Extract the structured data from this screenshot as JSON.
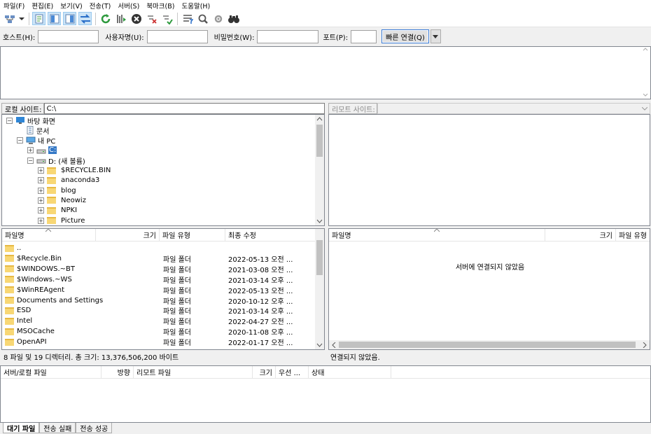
{
  "menu": [
    "파일(F)",
    "편집(E)",
    "보기(V)",
    "전송(T)",
    "서버(S)",
    "북마크(B)",
    "도움말(H)"
  ],
  "toolbar_icons": [
    "site-manager-icon",
    "dropdown-arrow-icon",
    "toggle-log-icon",
    "toggle-local-tree-icon",
    "toggle-remote-tree-icon",
    "toggle-queue-icon",
    "refresh-icon",
    "process-queue-icon",
    "cancel-icon",
    "disconnect-icon",
    "reconnect-icon",
    "directory-filter-icon",
    "dir-compare-icon",
    "sync-browse-icon",
    "search-remote-icon"
  ],
  "quickconnect": {
    "host_label": "호스트(H):",
    "user_label": "사용자명(U):",
    "password_label": "비밀번호(W):",
    "port_label": "포트(P):",
    "connect_label": "빠른 연결(Q)"
  },
  "local": {
    "site_label": "로컬 사이트:",
    "path": "C:\\",
    "tree": [
      {
        "label": "바탕 화면",
        "exp": "−",
        "icon": "desktop-icon",
        "indent": 0
      },
      {
        "label": "문서",
        "exp": "",
        "icon": "document-icon",
        "indent": 1
      },
      {
        "label": "내 PC",
        "exp": "−",
        "icon": "pc-icon",
        "indent": 1
      },
      {
        "label": "C:",
        "exp": "+",
        "icon": "drive-icon",
        "indent": 2,
        "selected": true
      },
      {
        "label": "D: (새 볼륨)",
        "exp": "−",
        "icon": "drive-icon",
        "indent": 2
      },
      {
        "label": "$RECYCLE.BIN",
        "exp": "+",
        "icon": "folder-icon",
        "indent": 3
      },
      {
        "label": "anaconda3",
        "exp": "+",
        "icon": "folder-icon",
        "indent": 3
      },
      {
        "label": "blog",
        "exp": "+",
        "icon": "folder-icon",
        "indent": 3
      },
      {
        "label": "Neowiz",
        "exp": "+",
        "icon": "folder-icon",
        "indent": 3
      },
      {
        "label": "NPKI",
        "exp": "+",
        "icon": "folder-icon",
        "indent": 3
      },
      {
        "label": "Picture",
        "exp": "+",
        "icon": "folder-icon",
        "indent": 3
      }
    ],
    "columns": {
      "name": "파일명",
      "size": "크기",
      "type": "파일 유형",
      "modified": "최종 수정"
    },
    "files": [
      {
        "name": "..",
        "type": "",
        "modified": ""
      },
      {
        "name": "$Recycle.Bin",
        "type": "파일 폴더",
        "modified": "2022-05-13 오전 ..."
      },
      {
        "name": "$WINDOWS.~BT",
        "type": "파일 폴더",
        "modified": "2021-03-08 오전 ..."
      },
      {
        "name": "$Windows.~WS",
        "type": "파일 폴더",
        "modified": "2021-03-14 오후 ..."
      },
      {
        "name": "$WinREAgent",
        "type": "파일 폴더",
        "modified": "2022-05-13 오전 ..."
      },
      {
        "name": "Documents and Settings",
        "type": "파일 폴더",
        "modified": "2020-10-12 오후 ..."
      },
      {
        "name": "ESD",
        "type": "파일 폴더",
        "modified": "2021-03-14 오후 ..."
      },
      {
        "name": "Intel",
        "type": "파일 폴더",
        "modified": "2022-04-27 오전 ..."
      },
      {
        "name": "MSOCache",
        "type": "파일 폴더",
        "modified": "2020-11-08 오후 ..."
      },
      {
        "name": "OpenAPI",
        "type": "파일 폴더",
        "modified": "2022-01-17 오전 ..."
      }
    ],
    "status": "8 파일 및 19 디렉터리. 총 크기: 13,376,506,200 바이트"
  },
  "remote": {
    "site_label": "리모트 사이트:",
    "path": "",
    "columns": {
      "name": "파일명",
      "size": "크기",
      "type": "파일 유형"
    },
    "empty_message": "서버에 연결되지 않았음",
    "status": "연결되지 않았음."
  },
  "queue": {
    "columns": {
      "server_file": "서버/로컬 파일",
      "direction": "방향",
      "remote_file": "리모트 파일",
      "size": "크기",
      "priority": "우선 ...",
      "status": "상태"
    },
    "tabs": [
      "대기 파일",
      "전송 실패",
      "전송 성공"
    ]
  }
}
